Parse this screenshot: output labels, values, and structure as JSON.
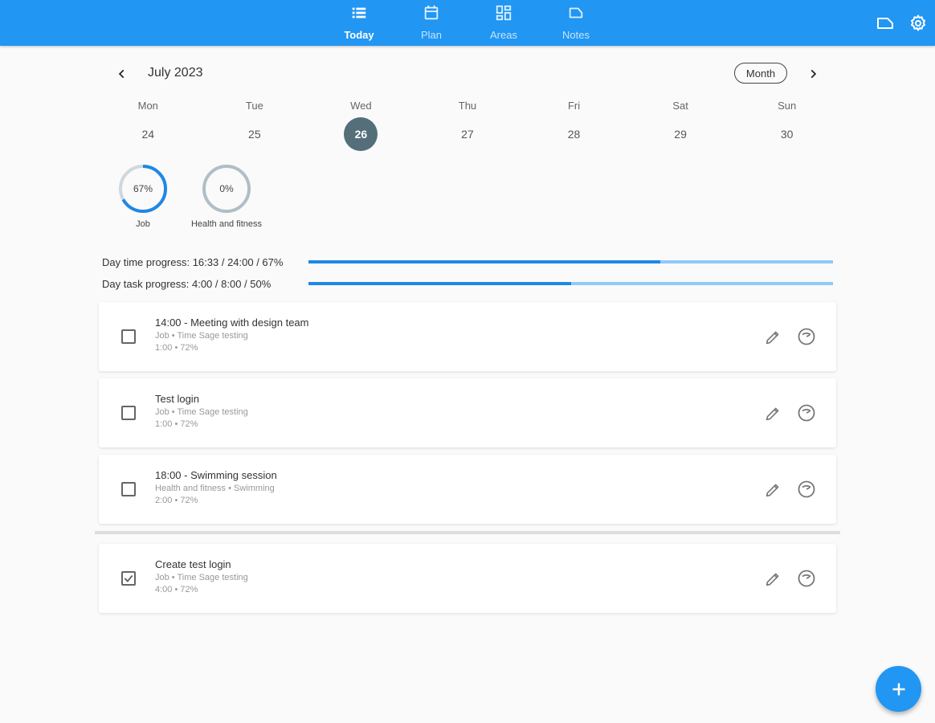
{
  "nav": {
    "items": [
      {
        "label": "Today",
        "icon": "list-icon"
      },
      {
        "label": "Plan",
        "icon": "calendar-icon"
      },
      {
        "label": "Areas",
        "icon": "dashboard-icon"
      },
      {
        "label": "Notes",
        "icon": "label-icon"
      }
    ],
    "active": "Today",
    "right_icons": [
      "label-outline-icon",
      "gear-icon"
    ]
  },
  "calendar": {
    "month_title": "July 2023",
    "view_button": "Month",
    "weekdays": [
      "Mon",
      "Tue",
      "Wed",
      "Thu",
      "Fri",
      "Sat",
      "Sun"
    ],
    "days": [
      "24",
      "25",
      "26",
      "27",
      "28",
      "29",
      "30"
    ],
    "selected_day": "26"
  },
  "areas": [
    {
      "name": "Job",
      "percent_label": "67%",
      "percent": 67
    },
    {
      "name": "Health and fitness",
      "percent_label": "0%",
      "percent": 0
    }
  ],
  "progress": {
    "time": {
      "label": "Day time progress: 16:33 / 24:00 / 67%",
      "fraction": 0.67
    },
    "task": {
      "label": "Day task progress: 4:00 / 8:00 / 50%",
      "fraction": 0.5
    }
  },
  "tasks": [
    {
      "title": "14:00 - Meeting with design team",
      "subtitle": "Job • Time Sage testing",
      "meta": "1:00 • 72%",
      "done": false
    },
    {
      "title": "Test login",
      "subtitle": "Job • Time Sage testing",
      "meta": "1:00 • 72%",
      "done": false
    },
    {
      "title": "18:00 - Swimming session",
      "subtitle": "Health and fitness • Swimming",
      "meta": "2:00 • 72%",
      "done": false
    },
    {
      "title": "Create test login",
      "subtitle": "Job • Time Sage testing",
      "meta": "4:00 • 72%",
      "done": true
    }
  ],
  "colors": {
    "primary": "#2196f3",
    "progress_fill": "#1e88e5",
    "progress_track": "#90caf9",
    "selected_day": "#546e7a"
  },
  "fab_icon": "plus-icon"
}
